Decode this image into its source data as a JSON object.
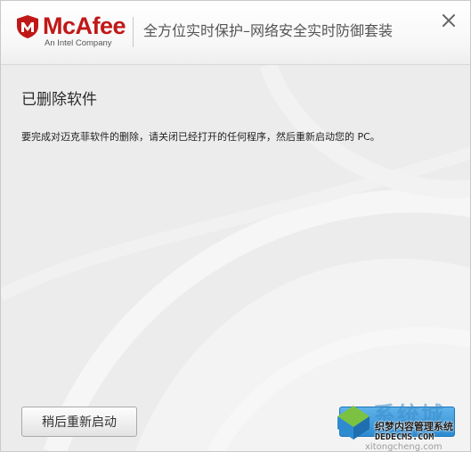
{
  "header": {
    "brand_name": "McAfee",
    "brand_tagline": "An Intel Company",
    "product_name": "全方位实时保护–网络安全实时防御套装"
  },
  "content": {
    "title": "已删除软件",
    "message": "要完成对迈克菲软件的删除，请关闭已经打开的任何程序，然后重新启动您的 PC。"
  },
  "buttons": {
    "restart_later": "稍后重新启动"
  },
  "watermark": {
    "title": "系统城",
    "line1": "织梦内容管理系统",
    "line2": "DEDECMS.COM",
    "line3": "xitongcheng.com"
  },
  "colors": {
    "brand_red": "#c01818",
    "primary_button": "#2d8ad0",
    "window_background": "#ececec"
  },
  "icons": {
    "logo": "mcafee-shield-icon",
    "close": "close-icon",
    "watermark_logo": "xitongcheng-logo-icon"
  }
}
